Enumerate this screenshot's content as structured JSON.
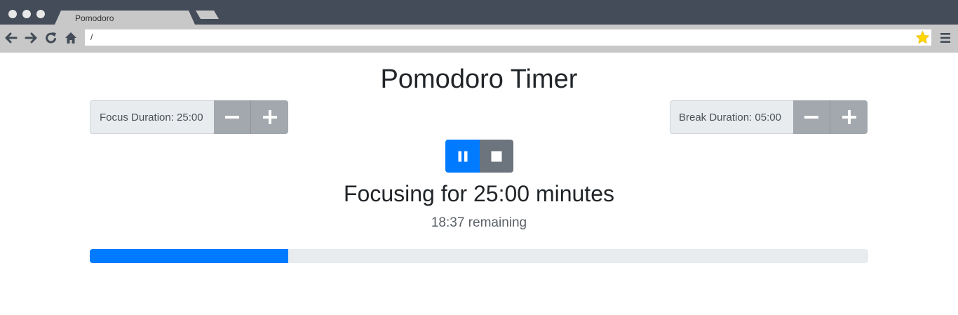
{
  "browser": {
    "tab_title": "Pomodoro",
    "address": "/",
    "icons": [
      "back-arrow-icon",
      "forward-arrow-icon",
      "reload-icon",
      "home-icon",
      "star-icon",
      "menu-icon"
    ]
  },
  "page": {
    "title": "Pomodoro Timer",
    "focus": {
      "label": "Focus Duration: 25:00",
      "decrease_icon": "minus-icon",
      "increase_icon": "plus-icon"
    },
    "break": {
      "label": "Break Duration: 05:00",
      "decrease_icon": "minus-icon",
      "increase_icon": "plus-icon"
    },
    "controls": {
      "pause_icon": "pause-icon",
      "stop_icon": "stop-icon"
    },
    "status": "Focusing for 25:00 minutes",
    "remaining": "18:37 remaining",
    "progress_fraction": 0.255
  },
  "colors": {
    "primary": "#007bff",
    "secondary": "#6c757d",
    "duration_button": "#a3a8ae",
    "star": "#ffd700",
    "chrome_dark": "#434c58",
    "chrome_light": "#c8c8c8"
  }
}
